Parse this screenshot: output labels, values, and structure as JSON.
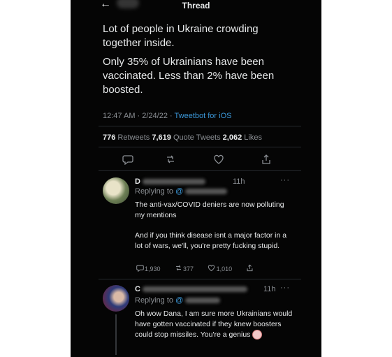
{
  "header": {
    "back_icon": "←",
    "title": "Thread"
  },
  "tweet": {
    "paragraph1": "Lot of people in Ukraine crowding together inside.",
    "paragraph2": "Only 35% of Ukrainians have been vaccinated. Less than 2% have been boosted.",
    "time": "12:47 AM · 2/24/22 · ",
    "client": "Tweetbot for iOS",
    "stats": {
      "retweets_count": "776",
      "retweets_label": "Retweets",
      "quotes_count": "7,619",
      "quotes_label": "Quote Tweets",
      "likes_count": "2,062",
      "likes_label": "Likes"
    },
    "action_icons": [
      "reply-icon",
      "retweet-icon",
      "like-icon",
      "share-icon"
    ]
  },
  "replies": [
    {
      "name_visible": "D",
      "time": "11h",
      "more": "···",
      "replying_prefix": "Replying to ",
      "handle_visible": "@",
      "text1": "The anti-vax/COVID deniers are now polluting my mentions",
      "text2": "And if you think disease isnt a major factor in a lot of wars, we'll, you're pretty fucking stupid.",
      "replies": "1,930",
      "retweets": "377",
      "likes": "1,010"
    },
    {
      "name_visible": "C",
      "time": "11h",
      "more": "···",
      "replying_prefix": "Replying to ",
      "handle_visible": "@",
      "text1": "Oh wow Dana, I am sure more Ukrainians would have gotten vaccinated if they knew boosters could stop missiles. You're a genius"
    }
  ],
  "colors": {
    "background": "#050505",
    "text": "#e7e9ea",
    "muted": "#8b8f94",
    "link": "#3b97d8"
  }
}
